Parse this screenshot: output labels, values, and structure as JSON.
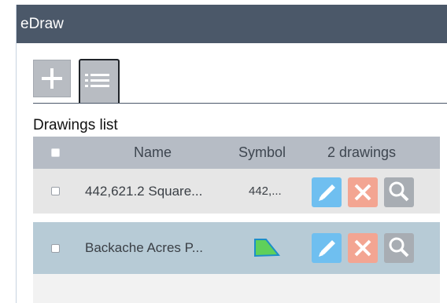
{
  "window": {
    "title": "eDraw"
  },
  "toolbar": {
    "add_icon": "plus-icon",
    "list_icon": "list-icon"
  },
  "list": {
    "heading": "Drawings list",
    "columns": {
      "name": "Name",
      "symbol": "Symbol",
      "count": "2 drawings"
    },
    "rows": [
      {
        "name": "442,621.2 Square...",
        "symbol_text": "442,...",
        "symbol_type": "text"
      },
      {
        "name": "Backache Acres P...",
        "symbol_type": "polygon",
        "symbol_fill": "#5fd05a",
        "symbol_stroke": "#1c8ec8"
      }
    ],
    "actions": {
      "edit_icon": "pencil-icon",
      "delete_icon": "close-icon",
      "zoom_icon": "magnifier-icon"
    }
  },
  "colors": {
    "titlebar": "#4b5869",
    "header_row": "#b6bcc5",
    "row_default": "#e6e6e6",
    "row_selected": "#b7cbd6",
    "edit": "#6fbff0",
    "delete": "#f3a592",
    "zoom": "#a8adb3"
  }
}
